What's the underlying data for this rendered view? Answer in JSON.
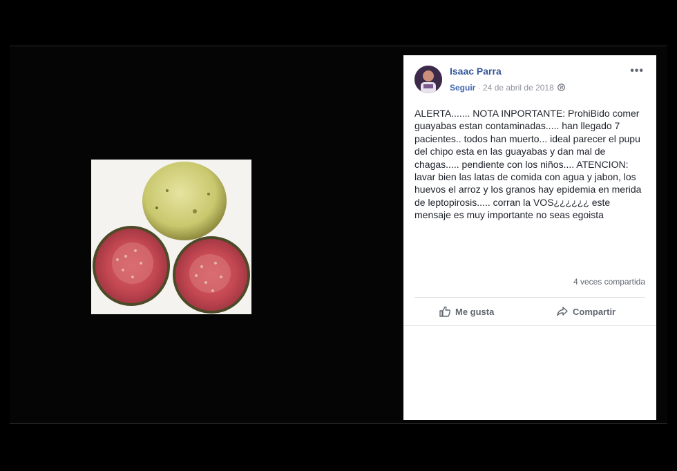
{
  "post": {
    "author": "Isaac Parra",
    "follow_label": "Seguir",
    "separator": " · ",
    "date": "24 de abril de 2018",
    "more_label": "•••",
    "text": "ALERTA....... NOTA INPORTANTE: ProhiBido comer guayabas estan contaminadas..... han llegado 7 pacientes.. todos han muerto... ideal parecer el pupu del chipo esta en las guayabas y dan mal de chagas..... pendiente con los niños.... ATENCION: lavar bien las latas de comida con agua y jabon, los huevos el arroz y los granos hay epidemia en merida de leptopirosis..... corran la VOS¿¿¿¿¿¿ este mensaje es muy importante no seas egoista",
    "shares": "4 veces compartida"
  },
  "actions": {
    "like_label": "Me gusta",
    "share_label": "Compartir"
  },
  "icons": {
    "globe": "globe-icon",
    "like": "thumbs-up-icon",
    "share": "share-arrow-icon",
    "more": "more-options-icon"
  },
  "colors": {
    "author": "#365899",
    "link": "#4267b2",
    "muted": "#90949c",
    "text": "#1d2129"
  }
}
